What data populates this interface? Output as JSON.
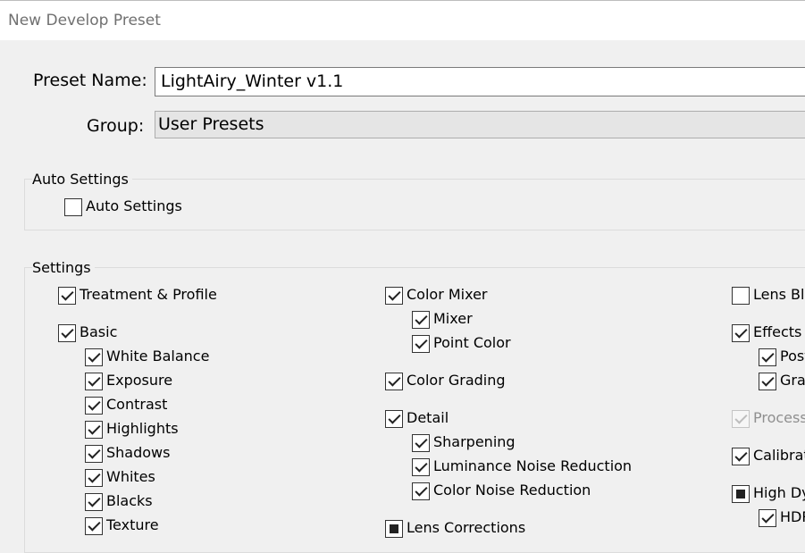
{
  "window": {
    "title": "New Develop Preset"
  },
  "form": {
    "preset_name_label": "Preset Name:",
    "preset_name_value": "LightAiry_Winter v1.1",
    "group_label": "Group:",
    "group_value": "User Presets"
  },
  "auto_settings": {
    "legend": "Auto Settings",
    "checkbox": {
      "label": "Auto Settings",
      "state": "unchecked"
    }
  },
  "settings": {
    "legend": "Settings",
    "items": [
      {
        "id": "treatment-profile",
        "label": "Treatment & Profile",
        "state": "checked"
      },
      {
        "id": "basic",
        "label": "Basic",
        "state": "checked"
      },
      {
        "id": "white-balance",
        "label": "White Balance",
        "state": "checked"
      },
      {
        "id": "exposure",
        "label": "Exposure",
        "state": "checked"
      },
      {
        "id": "contrast",
        "label": "Contrast",
        "state": "checked"
      },
      {
        "id": "highlights",
        "label": "Highlights",
        "state": "checked"
      },
      {
        "id": "shadows",
        "label": "Shadows",
        "state": "checked"
      },
      {
        "id": "whites",
        "label": "Whites",
        "state": "checked"
      },
      {
        "id": "blacks",
        "label": "Blacks",
        "state": "checked"
      },
      {
        "id": "texture",
        "label": "Texture",
        "state": "checked"
      },
      {
        "id": "color-mixer",
        "label": "Color Mixer",
        "state": "checked"
      },
      {
        "id": "mixer",
        "label": "Mixer",
        "state": "checked"
      },
      {
        "id": "point-color",
        "label": "Point Color",
        "state": "checked"
      },
      {
        "id": "color-grading",
        "label": "Color Grading",
        "state": "checked"
      },
      {
        "id": "detail",
        "label": "Detail",
        "state": "checked"
      },
      {
        "id": "sharpening",
        "label": "Sharpening",
        "state": "checked"
      },
      {
        "id": "luminance-noise-reduction",
        "label": "Luminance Noise Reduction",
        "state": "checked"
      },
      {
        "id": "color-noise-reduction",
        "label": "Color Noise Reduction",
        "state": "checked"
      },
      {
        "id": "lens-corrections",
        "label": "Lens Corrections",
        "state": "indeterminate"
      },
      {
        "id": "lens-blur",
        "label": "Lens Blu",
        "state": "unchecked"
      },
      {
        "id": "effects",
        "label": "Effects",
        "state": "checked"
      },
      {
        "id": "post-crop",
        "label": "Post",
        "state": "checked"
      },
      {
        "id": "grain",
        "label": "Grai",
        "state": "checked"
      },
      {
        "id": "process",
        "label": "Process",
        "state": "checked",
        "disabled": true
      },
      {
        "id": "calibration",
        "label": "Calibrat",
        "state": "checked"
      },
      {
        "id": "high-dynamic-range",
        "label": "High Dy",
        "state": "indeterminate"
      },
      {
        "id": "hdr",
        "label": "HDR",
        "state": "checked"
      }
    ]
  }
}
